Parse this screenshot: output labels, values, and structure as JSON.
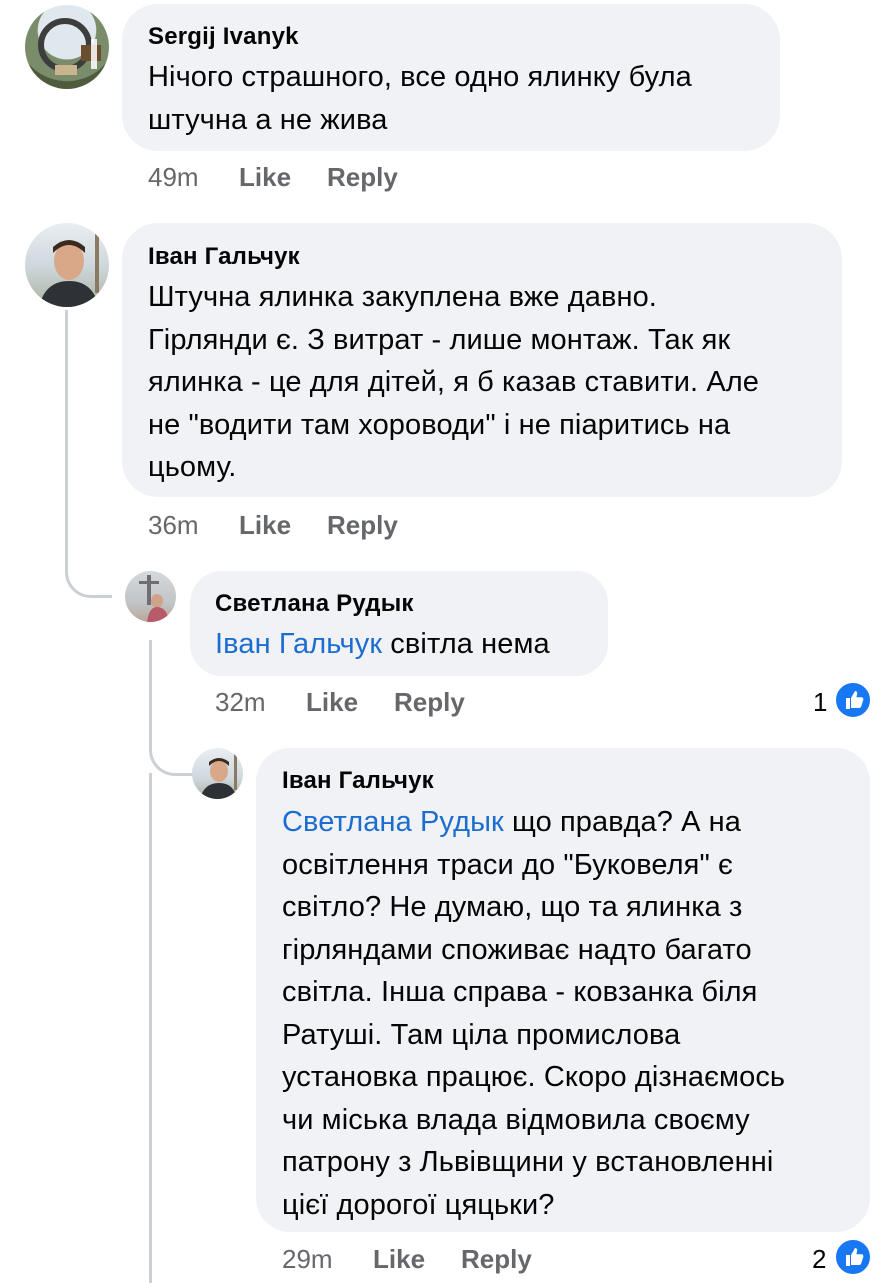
{
  "comments": [
    {
      "author": "Sergij Ivanyk",
      "lines": [
        "Нічого страшного, все одно ялинку була",
        "штучна а не жива"
      ],
      "time": "49m",
      "like": "Like",
      "reply": "Reply"
    },
    {
      "author": "Іван Гальчук",
      "lines": [
        "Штучна ялинка закуплена вже давно.",
        "Гірлянди є. З витрат - лише монтаж. Так як",
        "ялинка - це для дітей, я б казав ставити. Але",
        "не \"водити там хороводи\" і не піаритись на",
        "цьому."
      ],
      "time": "36m",
      "like": "Like",
      "reply": "Reply"
    },
    {
      "author": "Светлана Рудык",
      "mention": "Іван Гальчук",
      "text_after_mention": " світла нема",
      "time": "32m",
      "like": "Like",
      "reply": "Reply",
      "reaction_count": "1"
    },
    {
      "author": "Іван Гальчук",
      "mention": "Светлана Рудык",
      "first_line_rest": " що правда? А на",
      "lines": [
        "освітлення траси до \"Буковеля\" є",
        "світло? Не думаю, що та ялинка з",
        "гірляндами споживає надто багато",
        "світла. Інша справа - ковзанка біля",
        "Ратуші. Там ціла промислова",
        "установка працює. Скоро дізнаємось",
        "чи міська влада відмовила своєму",
        "патрону з Львівщини у встановленні",
        "цієї дорогої цяцьки?"
      ],
      "time": "29m",
      "like": "Like",
      "reply": "Reply",
      "reaction_count": "2"
    }
  ],
  "icons": {
    "reaction": "thumbs-up-icon"
  },
  "colors": {
    "bubble": "#f0f2f5",
    "mention": "#1c6dd0",
    "meta": "#65676b",
    "like_badge": "#1877f2"
  }
}
